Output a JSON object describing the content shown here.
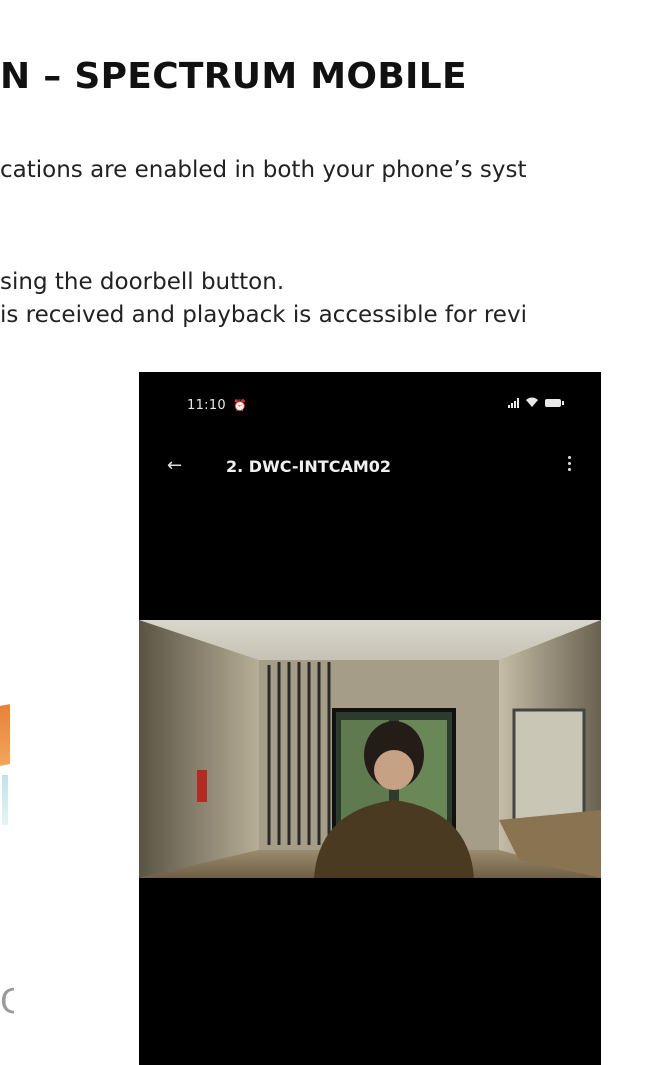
{
  "document": {
    "heading": "N – SPECTRUM MOBILE",
    "line1": "cations are enabled in both your phone’s syst",
    "line2": "sing the doorbell button.",
    "line3": "is received and playback is accessible for revi"
  },
  "phone": {
    "status_time": "11:10",
    "device_title": "2. DWC-INTCAM02",
    "icons": {
      "alarm": "alarm-clock-icon",
      "signal": "signal-icon",
      "wifi": "wifi-icon",
      "battery": "battery-icon",
      "back": "back-arrow-icon",
      "more": "more-vertical-icon"
    }
  },
  "colors": {
    "phone_background": "#000000",
    "status_text": "#e9e9e9"
  }
}
